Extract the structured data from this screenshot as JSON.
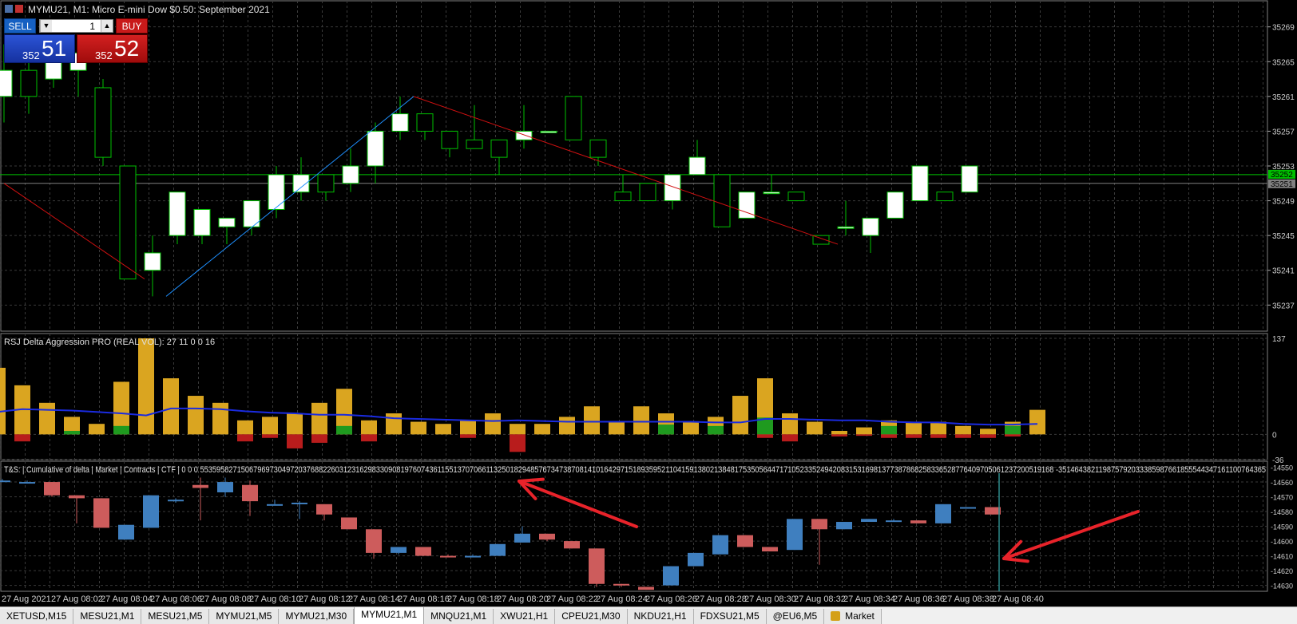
{
  "window": {
    "title": "MYMU21, M1:  Micro E-mini Dow $0.50: September 2021"
  },
  "trade_panel": {
    "sell_label": "SELL",
    "buy_label": "BUY",
    "lot_value": "1",
    "sell_price_prefix": "352",
    "sell_price_main": "51",
    "buy_price_prefix": "352",
    "buy_price_main": "52"
  },
  "colors": {
    "background": "#000000",
    "grid": "#3a3a3a",
    "bull_candle": "#ffffff",
    "candle_outline": "#00c000",
    "bid_line": "#00c000",
    "ask_line": "#808080",
    "trend_up": "#1e90ff",
    "trend_down": "#d01010",
    "volume_gold": "#daa520",
    "volume_green": "#1f9a1f",
    "volume_red": "#b81c1c",
    "ma_line": "#1a2be0",
    "delta_bull": "#3f7fbf",
    "delta_bear": "#cd5c5c",
    "annotation_arrow": "#e8232a"
  },
  "price_axis": {
    "ticks": [
      "35269",
      "35265",
      "35261",
      "35257",
      "35253",
      "35249",
      "35245",
      "35241",
      "35237"
    ],
    "bid_label": "35252",
    "ask_label": "35251"
  },
  "indicator1": {
    "title": "RSJ Delta Aggression PRO (REAL VOL): 27 11 0 0 16",
    "ticks": [
      "137",
      "0",
      "-36"
    ]
  },
  "indicator2": {
    "title": "T&S: | Cumulative of delta | Market | Contracts | CTF | 0 0 0 553595827150679697304972037688226031231629833090819760743611551370706611325018294857673473870814101642971518935952110415913802138481753505644717105233524942083153169813773878682583365287764097050612372005191​68 -351464382119875792033385987661855544347161100764365",
    "ticks": [
      "-14550",
      "-14560",
      "-14570",
      "-14580",
      "-14590",
      "-14600",
      "-14610",
      "-14620",
      "-14630"
    ]
  },
  "time_axis": {
    "labels": [
      "27 Aug 2021",
      "27 Aug 08:02",
      "27 Aug 08:04",
      "27 Aug 08:06",
      "27 Aug 08:08",
      "27 Aug 08:10",
      "27 Aug 08:12",
      "27 Aug 08:14",
      "27 Aug 08:16",
      "27 Aug 08:18",
      "27 Aug 08:20",
      "27 Aug 08:22",
      "27 Aug 08:24",
      "27 Aug 08:26",
      "27 Aug 08:28",
      "27 Aug 08:30",
      "27 Aug 08:32",
      "27 Aug 08:34",
      "27 Aug 08:36",
      "27 Aug 08:38",
      "27 Aug 08:40"
    ]
  },
  "tabs": [
    {
      "label": "XETUSD,M15",
      "active": false
    },
    {
      "label": "MESU21,M1",
      "active": false
    },
    {
      "label": "MESU21,M5",
      "active": false
    },
    {
      "label": "MYMU21,M5",
      "active": false
    },
    {
      "label": "MYMU21,M30",
      "active": false
    },
    {
      "label": "MYMU21,M1",
      "active": true
    },
    {
      "label": "MNQU21,M1",
      "active": false
    },
    {
      "label": "XWU21,H1",
      "active": false
    },
    {
      "label": "CPEU21,M30",
      "active": false
    },
    {
      "label": "NKDU21,H1",
      "active": false
    },
    {
      "label": "FDXSU21,M5",
      "active": false
    },
    {
      "label": "@EU6,M5",
      "active": false
    },
    {
      "label": "Market",
      "active": false
    }
  ],
  "chart_data": [
    {
      "type": "candlestick",
      "name": "MYMU21 M1 price",
      "ylim": [
        35234,
        35272
      ],
      "candles": [
        {
          "o": 35261,
          "h": 35267,
          "l": 35258,
          "c": 35264
        },
        {
          "o": 35264,
          "h": 35266,
          "l": 35259,
          "c": 35261
        },
        {
          "o": 35263,
          "h": 35267,
          "l": 35262,
          "c": 35266
        },
        {
          "o": 35264,
          "h": 35266,
          "l": 35261,
          "c": 35266
        },
        {
          "o": 35262,
          "h": 35263,
          "l": 35253,
          "c": 35254
        },
        {
          "o": 35253,
          "h": 35253,
          "l": 35240,
          "c": 35240
        },
        {
          "o": 35241,
          "h": 35245,
          "l": 35238,
          "c": 35243
        },
        {
          "o": 35245,
          "h": 35250,
          "l": 35244,
          "c": 35250
        },
        {
          "o": 35245,
          "h": 35248,
          "l": 35244,
          "c": 35248
        },
        {
          "o": 35246,
          "h": 35247,
          "l": 35244,
          "c": 35247
        },
        {
          "o": 35246,
          "h": 35249,
          "l": 35245,
          "c": 35249
        },
        {
          "o": 35248,
          "h": 35253,
          "l": 35247,
          "c": 35252
        },
        {
          "o": 35250,
          "h": 35254,
          "l": 35249,
          "c": 35252
        },
        {
          "o": 35252,
          "h": 35252,
          "l": 35249,
          "c": 35250
        },
        {
          "o": 35251,
          "h": 35255,
          "l": 35250,
          "c": 35253
        },
        {
          "o": 35253,
          "h": 35258,
          "l": 35251,
          "c": 35257
        },
        {
          "o": 35257,
          "h": 35261,
          "l": 35256,
          "c": 35259
        },
        {
          "o": 35259,
          "h": 35259,
          "l": 35256,
          "c": 35257
        },
        {
          "o": 35257,
          "h": 35257,
          "l": 35254,
          "c": 35255
        },
        {
          "o": 35256,
          "h": 35260,
          "l": 35255,
          "c": 35255
        },
        {
          "o": 35256,
          "h": 35256,
          "l": 35252,
          "c": 35254
        },
        {
          "o": 35256,
          "h": 35260,
          "l": 35255,
          "c": 35257
        },
        {
          "o": 35257,
          "h": 35257,
          "l": 35257,
          "c": 35257
        },
        {
          "o": 35261,
          "h": 35261,
          "l": 35256,
          "c": 35256
        },
        {
          "o": 35256,
          "h": 35256,
          "l": 35253,
          "c": 35254
        },
        {
          "o": 35250,
          "h": 35252,
          "l": 35249,
          "c": 35249
        },
        {
          "o": 35251,
          "h": 35251,
          "l": 35249,
          "c": 35249
        },
        {
          "o": 35249,
          "h": 35252,
          "l": 35248,
          "c": 35252
        },
        {
          "o": 35252,
          "h": 35256,
          "l": 35252,
          "c": 35254
        },
        {
          "o": 35252,
          "h": 35252,
          "l": 35246,
          "c": 35246
        },
        {
          "o": 35247,
          "h": 35250,
          "l": 35247,
          "c": 35250
        },
        {
          "o": 35250,
          "h": 35252,
          "l": 35250,
          "c": 35250
        },
        {
          "o": 35250,
          "h": 35250,
          "l": 35249,
          "c": 35249
        },
        {
          "o": 35245,
          "h": 35245,
          "l": 35244,
          "c": 35244
        },
        {
          "o": 35246,
          "h": 35249,
          "l": 35245,
          "c": 35246
        },
        {
          "o": 35245,
          "h": 35247,
          "l": 35243,
          "c": 35247
        },
        {
          "o": 35247,
          "h": 35250,
          "l": 35247,
          "c": 35250
        },
        {
          "o": 35249,
          "h": 35253,
          "l": 35249,
          "c": 35253
        },
        {
          "o": 35250,
          "h": 35250,
          "l": 35249,
          "c": 35249
        },
        {
          "o": 35250,
          "h": 35253,
          "l": 35250,
          "c": 35253
        }
      ],
      "bid": 35252,
      "ask": 35251
    },
    {
      "type": "bar",
      "name": "RSJ Delta Aggression PRO",
      "ylim": [
        -36,
        137
      ],
      "total": [
        95,
        70,
        45,
        25,
        15,
        75,
        137,
        80,
        55,
        45,
        20,
        25,
        30,
        45,
        65,
        20,
        30,
        18,
        15,
        20,
        30,
        15,
        15,
        25,
        40,
        18,
        40,
        30,
        18,
        25,
        55,
        80,
        30,
        18,
        5,
        10,
        20,
        18,
        18,
        12,
        8,
        18,
        35
      ],
      "buy": [
        0,
        0,
        0,
        5,
        0,
        12,
        0,
        0,
        0,
        0,
        0,
        0,
        0,
        0,
        12,
        0,
        0,
        0,
        0,
        0,
        0,
        0,
        0,
        0,
        0,
        0,
        0,
        14,
        0,
        12,
        0,
        24,
        0,
        0,
        0,
        0,
        12,
        0,
        0,
        0,
        0,
        12
      ],
      "sell": [
        0,
        -10,
        0,
        0,
        0,
        0,
        0,
        0,
        0,
        0,
        -10,
        -5,
        -20,
        -12,
        0,
        -10,
        0,
        0,
        0,
        -5,
        0,
        -25,
        0,
        0,
        0,
        0,
        0,
        0,
        0,
        0,
        0,
        -5,
        -10,
        0,
        -3,
        -2,
        -5,
        -5,
        -5,
        -5,
        -5,
        -3,
        0
      ],
      "ma": [
        32,
        36,
        35,
        34,
        32,
        30,
        27,
        37,
        37,
        36,
        33,
        31,
        30,
        28,
        28,
        26,
        23,
        22,
        21,
        20,
        19,
        20,
        19,
        18,
        18,
        18,
        18,
        18,
        18,
        17,
        17,
        22,
        22,
        21,
        20,
        20,
        18,
        17,
        17,
        15,
        14,
        14,
        15
      ]
    },
    {
      "type": "candlestick",
      "name": "Cumulative of delta",
      "ylim": [
        -14634,
        -14547
      ],
      "candles": [
        {
          "o": -14559,
          "h": -14558,
          "l": -14560,
          "c": -14559
        },
        {
          "o": -14560,
          "h": -14559,
          "l": -14560,
          "c": -14560
        },
        {
          "o": -14560,
          "h": -14560,
          "l": -14570,
          "c": -14569
        },
        {
          "o": -14569,
          "h": -14569,
          "l": -14588,
          "c": -14571
        },
        {
          "o": -14571,
          "h": -14571,
          "l": -14590,
          "c": -14591
        },
        {
          "o": -14599,
          "h": -14589,
          "l": -14599,
          "c": -14589
        },
        {
          "o": -14591,
          "h": -14569,
          "l": -14591,
          "c": -14569
        },
        {
          "o": -14572,
          "h": -14571,
          "l": -14574,
          "c": -14572
        },
        {
          "o": -14562,
          "h": -14557,
          "l": -14586,
          "c": -14564
        },
        {
          "o": -14567,
          "h": -14557,
          "l": -14570,
          "c": -14560
        },
        {
          "o": -14562,
          "h": -14559,
          "l": -14583,
          "c": -14573
        },
        {
          "o": -14575,
          "h": -14572,
          "l": -14575,
          "c": -14575
        },
        {
          "o": -14574,
          "h": -14573,
          "l": -14585,
          "c": -14574
        },
        {
          "o": -14575,
          "h": -14575,
          "l": -14586,
          "c": -14582
        },
        {
          "o": -14584,
          "h": -14584,
          "l": -14592,
          "c": -14592
        },
        {
          "o": -14592,
          "h": -14592,
          "l": -14612,
          "c": -14608
        },
        {
          "o": -14608,
          "h": -14608,
          "l": -14609,
          "c": -14604
        },
        {
          "o": -14604,
          "h": -14604,
          "l": -14610,
          "c": -14610
        },
        {
          "o": -14610,
          "h": -14609,
          "l": -14611,
          "c": -14611
        },
        {
          "o": -14610,
          "h": -14609,
          "l": -14611,
          "c": -14610
        },
        {
          "o": -14610,
          "h": -14602,
          "l": -14610,
          "c": -14602
        },
        {
          "o": -14601,
          "h": -14590,
          "l": -14601,
          "c": -14595
        },
        {
          "o": -14595,
          "h": -14595,
          "l": -14600,
          "c": -14599
        },
        {
          "o": -14600,
          "h": -14600,
          "l": -14605,
          "c": -14605
        },
        {
          "o": -14605,
          "h": -14605,
          "l": -14631,
          "c": -14629
        },
        {
          "o": -14629,
          "h": -14629,
          "l": -14631,
          "c": -14630
        },
        {
          "o": -14631,
          "h": -14631,
          "l": -14633,
          "c": -14633
        },
        {
          "o": -14630,
          "h": -14617,
          "l": -14630,
          "c": -14617
        },
        {
          "o": -14617,
          "h": -14608,
          "l": -14617,
          "c": -14608
        },
        {
          "o": -14609,
          "h": -14596,
          "l": -14609,
          "c": -14596
        },
        {
          "o": -14596,
          "h": -14596,
          "l": -14604,
          "c": -14604
        },
        {
          "o": -14604,
          "h": -14604,
          "l": -14607,
          "c": -14607
        },
        {
          "o": -14606,
          "h": -14585,
          "l": -14606,
          "c": -14585
        },
        {
          "o": -14585,
          "h": -14585,
          "l": -14616,
          "c": -14592
        },
        {
          "o": -14592,
          "h": -14587,
          "l": -14592,
          "c": -14587
        },
        {
          "o": -14587,
          "h": -14585,
          "l": -14587,
          "c": -14585
        },
        {
          "o": -14586,
          "h": -14585,
          "l": -14587,
          "c": -14586
        },
        {
          "o": -14586,
          "h": -14586,
          "l": -14588,
          "c": -14588
        },
        {
          "o": -14588,
          "h": -14575,
          "l": -14588,
          "c": -14575
        },
        {
          "o": -14577,
          "h": -14577,
          "l": -14577,
          "c": -14577
        },
        {
          "o": -14577,
          "h": -14577,
          "l": -14582,
          "c": -14582
        }
      ]
    }
  ]
}
